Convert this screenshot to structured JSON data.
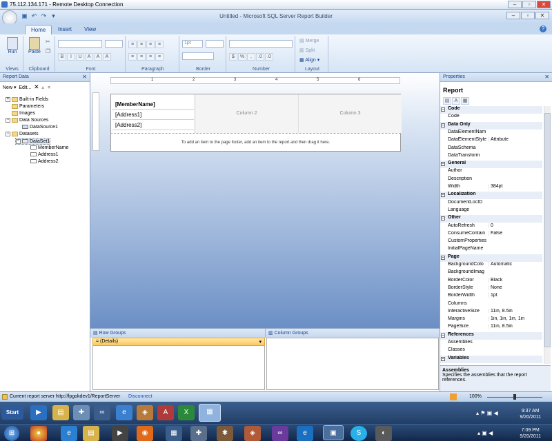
{
  "rdp": {
    "title": "75.112.134.171 - Remote Desktop Connection",
    "minimize": "–",
    "restore": "▫",
    "close": "✕"
  },
  "window": {
    "title": "Untitled - Microsoft SQL Server Report Builder",
    "minimize": "–",
    "restore": "▫",
    "close": "✕"
  },
  "ribbon": {
    "tabs": [
      "Home",
      "Insert",
      "View"
    ],
    "groups": {
      "views": "Views",
      "clipboard": "Clipboard",
      "font": "Font",
      "paragraph": "Paragraph",
      "border": "Border",
      "number": "Number",
      "layout": "Layout"
    },
    "run": "Run",
    "paste": "Paste",
    "border_width": "1pt",
    "layout_items": [
      "Merge",
      "Split",
      "Align"
    ]
  },
  "report_data": {
    "title": "Report Data",
    "new": "New",
    "edit": "Edit...",
    "tree": [
      "Built-in Fields",
      "Parameters",
      "Images",
      "Data Sources",
      "DataSource1",
      "Datasets",
      "DataSet1",
      "MemberName",
      "Address1",
      "Address2"
    ]
  },
  "ruler": {
    "ticks": [
      "1",
      "2",
      "3",
      "4",
      "5",
      "6"
    ]
  },
  "report": {
    "cells": [
      "[MemberName]",
      "[Address1]",
      "[Address2]"
    ],
    "columns": [
      "Column 2",
      "Column 3"
    ],
    "footer_hint": "To add an item to the page footer, add an item to the report and then drag it here."
  },
  "groups": {
    "row": "Row Groups",
    "column": "Column Groups",
    "details": "= (Details)"
  },
  "properties": {
    "title": "Properties",
    "object": "Report",
    "rows": [
      {
        "cat": true,
        "k": "Code"
      },
      {
        "k": "Code",
        "v": ""
      },
      {
        "cat": true,
        "k": "Data Only"
      },
      {
        "k": "DataElementNam",
        "v": ""
      },
      {
        "k": "DataElementStyle",
        "v": "Attribute"
      },
      {
        "k": "DataSchema",
        "v": ""
      },
      {
        "k": "DataTransform",
        "v": ""
      },
      {
        "cat": true,
        "k": "General"
      },
      {
        "k": "Author",
        "v": ""
      },
      {
        "k": "Description",
        "v": ""
      },
      {
        "k": "Width",
        "v": "384pt"
      },
      {
        "cat": true,
        "k": "Localization"
      },
      {
        "k": "DocumentLocID",
        "v": ""
      },
      {
        "k": "Language",
        "v": ""
      },
      {
        "cat": true,
        "k": "Other"
      },
      {
        "k": "AutoRefresh",
        "v": "0"
      },
      {
        "k": "ConsumeContain",
        "v": "False"
      },
      {
        "k": "CustomProperties",
        "v": ""
      },
      {
        "k": "InitialPageName",
        "v": ""
      },
      {
        "cat": true,
        "k": "Page"
      },
      {
        "k": "BackgroundColo",
        "v": "Automatic"
      },
      {
        "k": "BackgroundImag",
        "v": ""
      },
      {
        "k": "BorderColor",
        "v": "Black"
      },
      {
        "k": "BorderStyle",
        "v": "None"
      },
      {
        "k": "BorderWidth",
        "v": "1pt"
      },
      {
        "k": "Columns",
        "v": ""
      },
      {
        "k": "InteractiveSize",
        "v": "11in, 8.5in"
      },
      {
        "k": "Margins",
        "v": "1in, 1in, 1in, 1in"
      },
      {
        "k": "PageSize",
        "v": "11in, 8.5in"
      },
      {
        "cat": true,
        "k": "References"
      },
      {
        "k": "Assemblies",
        "v": ""
      },
      {
        "k": "Classes",
        "v": ""
      },
      {
        "cat": true,
        "k": "Variables"
      }
    ],
    "desc_title": "Assemblies",
    "desc_text": "Specifies the assemblies that the report references."
  },
  "status": {
    "server": "Current report server http://fpgokdev1/ReportServer",
    "disconnect": "Disconnect",
    "zoom": "100%"
  },
  "taskbar": {
    "start": "Start",
    "time1": "9:37 AM",
    "date1": "9/20/2011",
    "time2": "7:09 PM",
    "date2": "9/20/2011"
  }
}
